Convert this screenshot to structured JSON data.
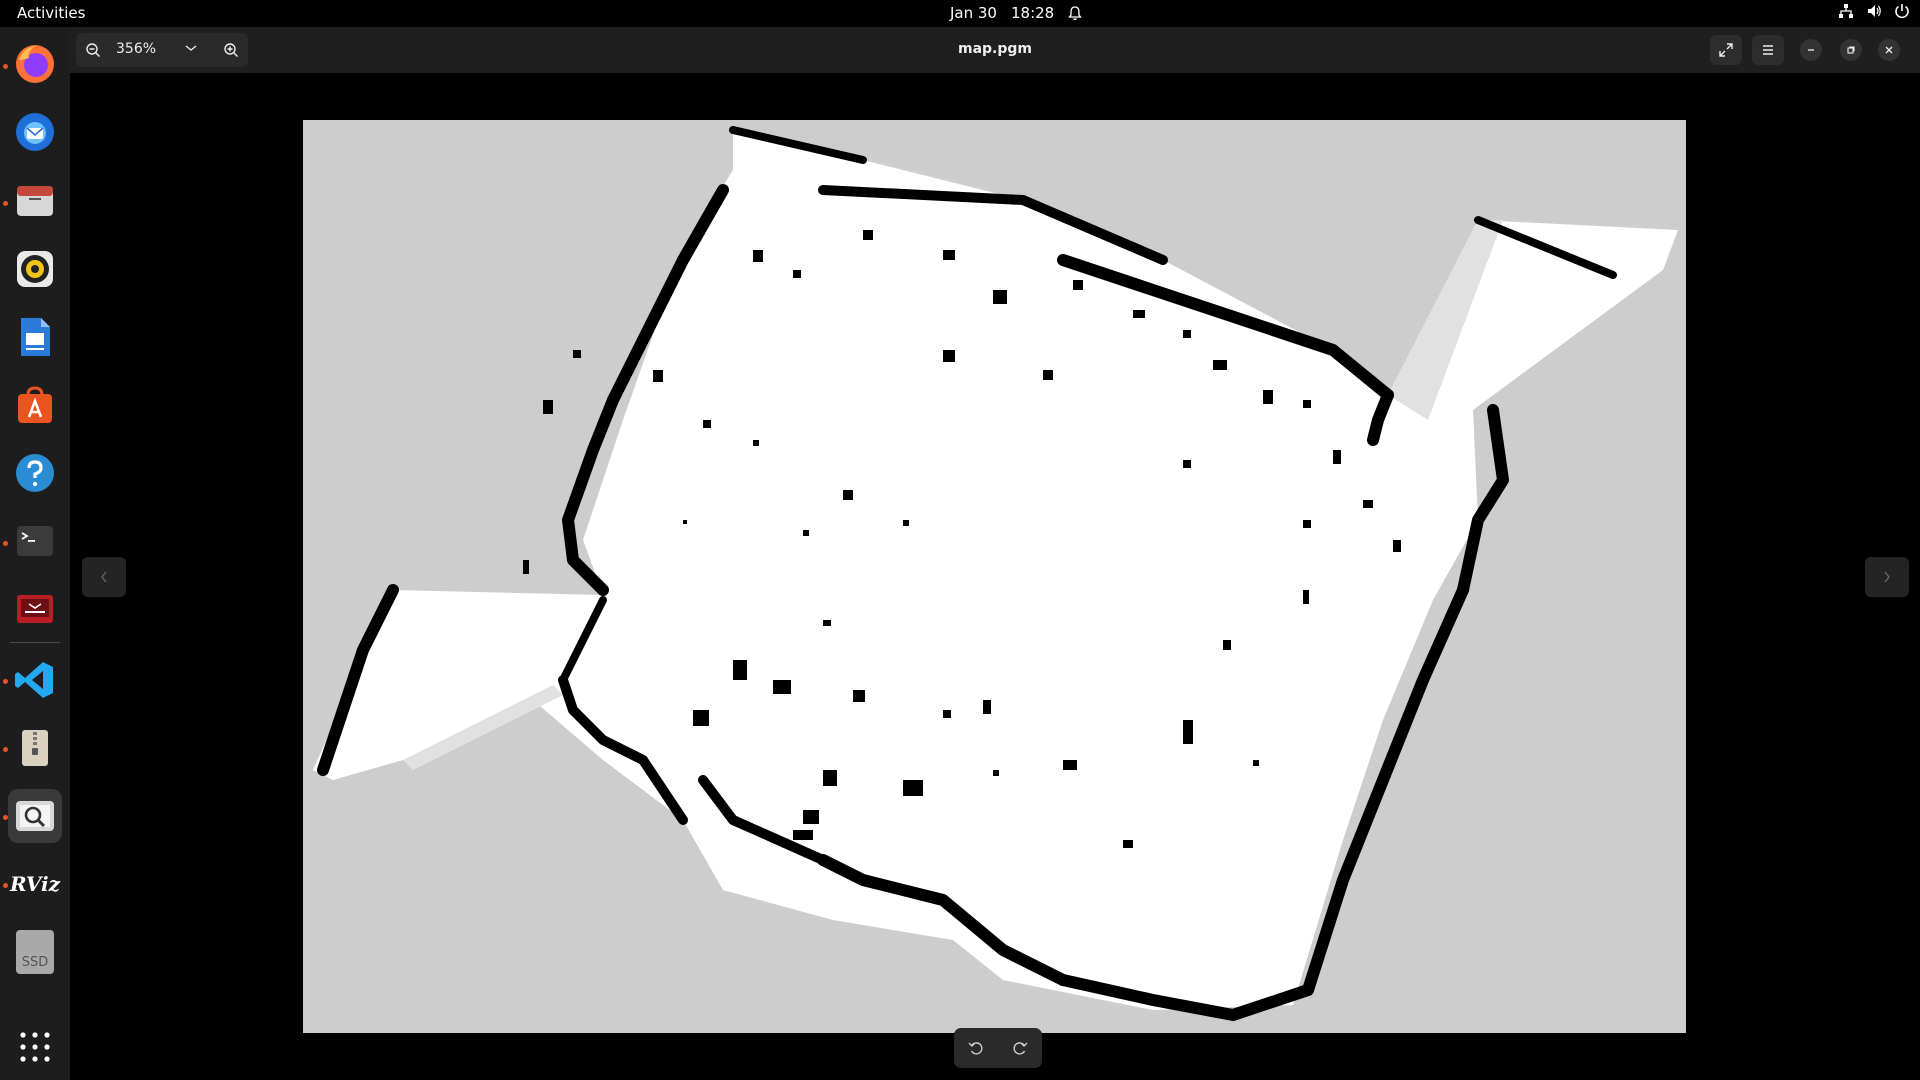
{
  "topbar": {
    "activities": "Activities",
    "date": "Jan 30",
    "time": "18:28"
  },
  "dock": {
    "items": [
      {
        "name": "firefox",
        "running": true
      },
      {
        "name": "thunderbird",
        "running": false
      },
      {
        "name": "files",
        "running": true
      },
      {
        "name": "rhythmbox",
        "running": false
      },
      {
        "name": "writer",
        "running": false
      },
      {
        "name": "app-center",
        "running": false
      },
      {
        "name": "help",
        "running": false
      },
      {
        "name": "terminal",
        "running": true
      },
      {
        "name": "remote-desktop",
        "running": false
      },
      {
        "name": "vscode",
        "running": true
      },
      {
        "name": "archive",
        "running": true
      },
      {
        "name": "image-viewer",
        "running": true,
        "active": true
      },
      {
        "name": "rviz",
        "running": true
      },
      {
        "name": "ssd",
        "running": false
      }
    ],
    "rviz_label": "RViz",
    "ssd_label": "SSD"
  },
  "viewer": {
    "zoom_level": "356%",
    "title": "map.pgm"
  },
  "colors": {
    "accent": "#e95420",
    "map_unknown": "#cdcdcd",
    "map_free": "#ffffff",
    "map_occupied": "#000000"
  }
}
